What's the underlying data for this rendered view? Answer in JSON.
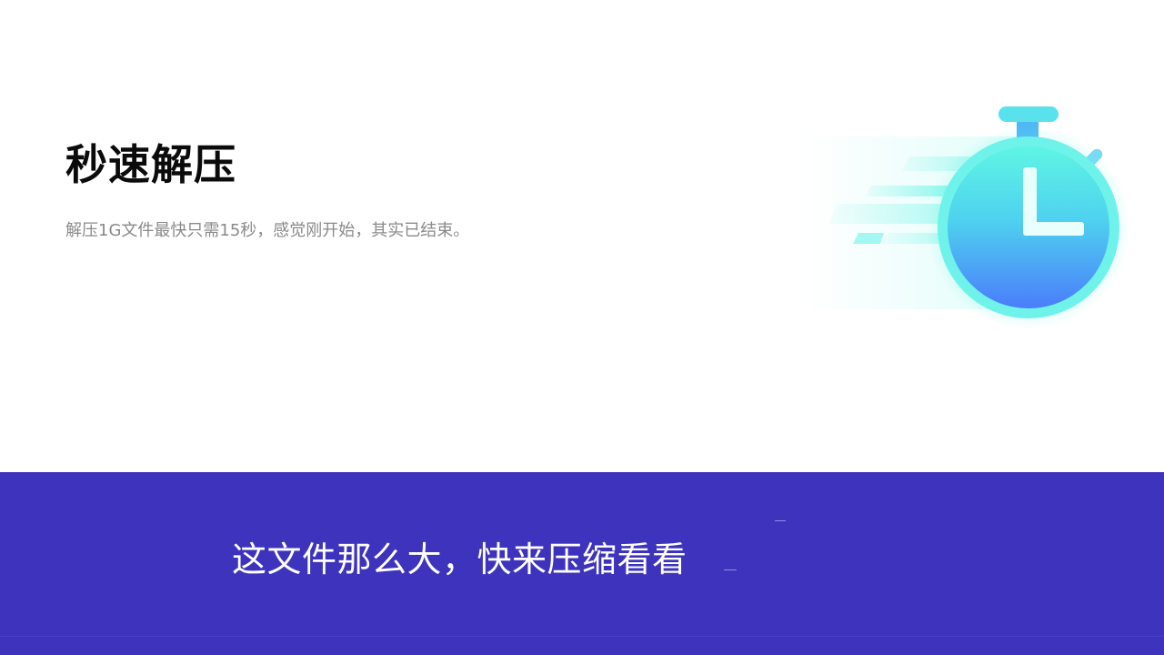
{
  "feature": {
    "title": "秒速解压",
    "description": "解压1G文件最快只需15秒，感觉刚开始，其实已结束。",
    "illustration_icon": "stopwatch-icon"
  },
  "banner": {
    "text": "这文件那么大，快来压缩看看"
  },
  "colors": {
    "banner_background": "#3e33bd",
    "title": "#0b0b0b",
    "description": "#8a8a8a",
    "stopwatch_top": "#5ef5e4",
    "stopwatch_bottom": "#4a7dfb"
  }
}
